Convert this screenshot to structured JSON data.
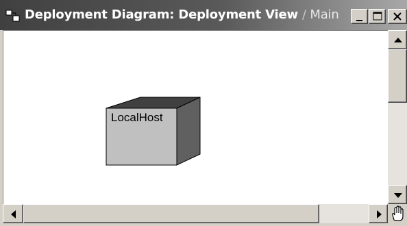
{
  "window": {
    "title_prefix": "Deployment Diagram: Deployment View ",
    "title_separator": "/",
    "title_suffix": " Main",
    "controls": {
      "minimize_icon": "minimize-icon",
      "maximize_icon": "maximize-icon",
      "close_icon": "close-icon"
    }
  },
  "diagram": {
    "nodes": [
      {
        "label": "LocalHost",
        "shape": "3d-box-node",
        "colors": {
          "front": "#c0c0c0",
          "top": "#404040",
          "side": "#606060"
        }
      }
    ]
  },
  "scrollbars": {
    "vertical": {
      "up_icon": "arrow-up-icon",
      "down_icon": "arrow-down-icon"
    },
    "horizontal": {
      "left_icon": "arrow-left-icon",
      "right_icon": "arrow-right-icon"
    },
    "corner_icon": "hand-pan-icon"
  }
}
